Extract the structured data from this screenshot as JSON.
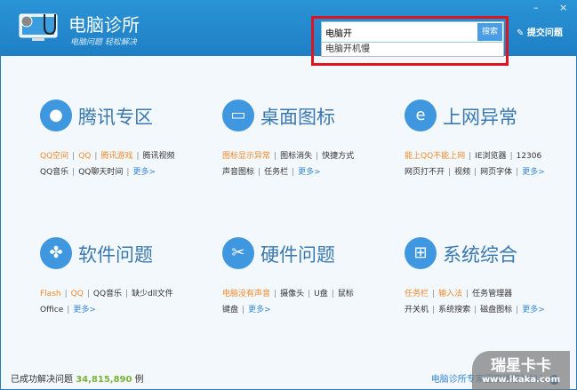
{
  "app": {
    "title": "电脑诊所",
    "slogan": "电脑问题 轻松解决",
    "minimize": "–",
    "close": "×",
    "submit": "提交问题"
  },
  "search": {
    "value": "电脑开",
    "button": "搜索",
    "suggestion": "电脑开机慢"
  },
  "categories": [
    {
      "title": "腾讯专区",
      "icon": "qq-penguin-icon",
      "row1": [
        [
          "QQ空间",
          "o"
        ],
        [
          "QQ",
          "o"
        ],
        [
          "腾讯游戏",
          "o"
        ],
        [
          "腾讯视频",
          ""
        ]
      ],
      "row2": [
        [
          "QQ音乐",
          ""
        ],
        [
          "QQ聊天时间",
          ""
        ],
        [
          "更多>",
          "b"
        ]
      ]
    },
    {
      "title": "桌面图标",
      "icon": "monitor-icon",
      "row1": [
        [
          "图标显示异常",
          "o"
        ],
        [
          "图标消失",
          ""
        ],
        [
          "快捷方式",
          ""
        ]
      ],
      "row2": [
        [
          "声音图标",
          ""
        ],
        [
          "任务栏",
          ""
        ],
        [
          "更多>",
          "b"
        ]
      ]
    },
    {
      "title": "上网异常",
      "icon": "ie-icon",
      "row1": [
        [
          "能上QQ不能上网",
          "o"
        ],
        [
          "IE浏览器",
          ""
        ],
        [
          "12306",
          ""
        ]
      ],
      "row2": [
        [
          "网页打不开",
          ""
        ],
        [
          "视频",
          ""
        ],
        [
          "网页字体",
          ""
        ],
        [
          "更多>",
          "b"
        ]
      ]
    },
    {
      "title": "软件问题",
      "icon": "clover-icon",
      "row1": [
        [
          "Flash",
          "o"
        ],
        [
          "QQ",
          "o"
        ],
        [
          "QQ音乐",
          ""
        ],
        [
          "缺少dll文件",
          ""
        ]
      ],
      "row2": [
        [
          "Office",
          ""
        ],
        [
          "更多>",
          "b"
        ]
      ]
    },
    {
      "title": "硬件问题",
      "icon": "hardware-tool-icon",
      "row1": [
        [
          "电脑没有声音",
          "o"
        ],
        [
          "摄像头",
          ""
        ],
        [
          "U盘",
          ""
        ],
        [
          "鼠标",
          ""
        ]
      ],
      "row2": [
        [
          "键盘",
          ""
        ],
        [
          "更多>",
          "b"
        ]
      ]
    },
    {
      "title": "系统综合",
      "icon": "windows-icon",
      "row1": [
        [
          "任务栏",
          "o"
        ],
        [
          "输入法",
          "o"
        ],
        [
          "任务管理器",
          ""
        ]
      ],
      "row2": [
        [
          "开关机",
          ""
        ],
        [
          "系统搜索",
          ""
        ],
        [
          "磁盘图标",
          ""
        ],
        [
          "更多>",
          "b"
        ]
      ]
    }
  ],
  "footer": {
    "prefix": "已成功解决问题",
    "count": "34,815,890",
    "suffix": "例",
    "join": "电脑诊所专家团期待您的加入"
  },
  "watermark": {
    "name": "瑞星卡卡",
    "url": "www.ikaka.com"
  }
}
